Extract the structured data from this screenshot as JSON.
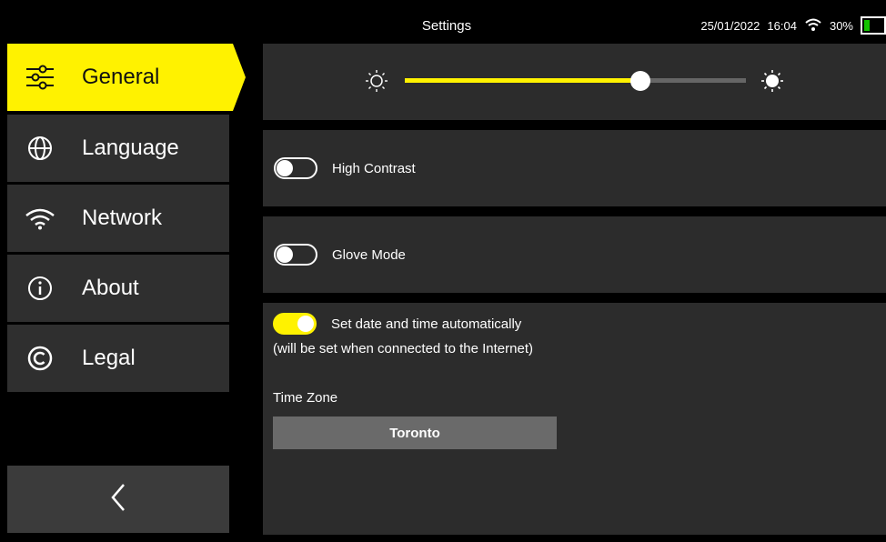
{
  "header": {
    "title": "Settings",
    "date": "25/01/2022",
    "time": "16:04",
    "battery_text": "30%",
    "battery_level": 0.3
  },
  "sidebar": {
    "items": [
      {
        "label": "General",
        "icon": "sliders-icon",
        "active": true
      },
      {
        "label": "Language",
        "icon": "globe-icon",
        "active": false
      },
      {
        "label": "Network",
        "icon": "wifi-icon",
        "active": false
      },
      {
        "label": "About",
        "icon": "info-icon",
        "active": false
      },
      {
        "label": "Legal",
        "icon": "copyright-icon",
        "active": false
      }
    ],
    "back_icon": "chevron-left-icon"
  },
  "settings": {
    "brightness": {
      "value": 0.69
    },
    "high_contrast": {
      "label": "High Contrast",
      "enabled": false
    },
    "glove_mode": {
      "label": "Glove Mode",
      "enabled": false
    },
    "auto_time": {
      "label": "Set date and time automatically",
      "note": "(will be set when connected to the Internet)",
      "enabled": true
    },
    "time_zone": {
      "label": "Time Zone",
      "value": "Toronto"
    }
  },
  "colors": {
    "accent": "#fff200",
    "panel": "#2c2c2c",
    "nav": "#2f2f2f",
    "battery": "#13c200"
  }
}
